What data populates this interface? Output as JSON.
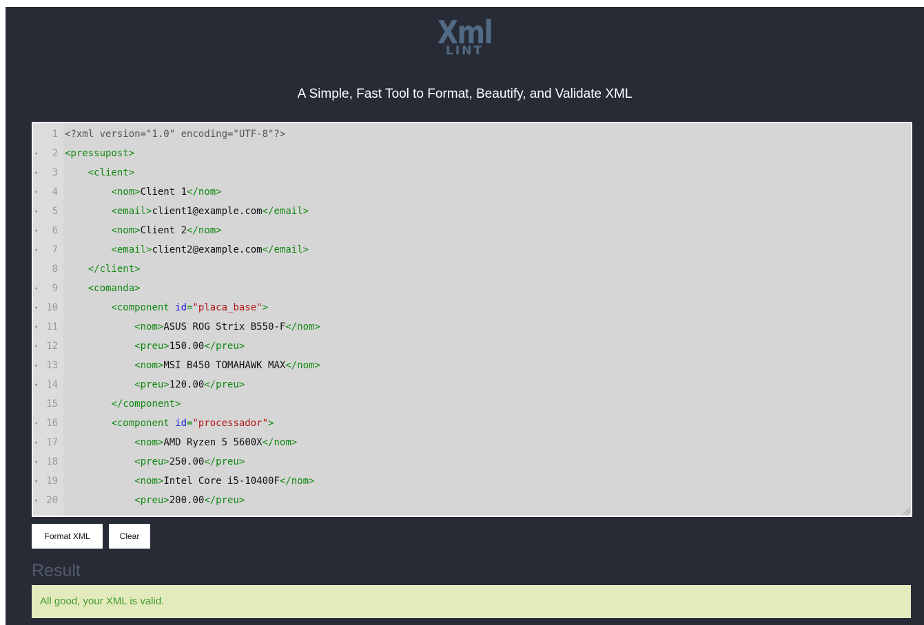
{
  "header": {
    "logo_main": "Xml",
    "logo_sub": "LINT",
    "tagline": "A Simple, Fast Tool to Format, Beautify, and Validate XML"
  },
  "editor": {
    "lines": [
      {
        "n": "1",
        "fold": false,
        "indent": 0,
        "tokens": [
          [
            "decl",
            "<?xml version=\"1.0\" encoding=\"UTF-8\"?>"
          ]
        ]
      },
      {
        "n": "2",
        "fold": true,
        "indent": 0,
        "tokens": [
          [
            "tag",
            "<pressupost>"
          ]
        ]
      },
      {
        "n": "3",
        "fold": true,
        "indent": 1,
        "tokens": [
          [
            "tag",
            "<client>"
          ]
        ]
      },
      {
        "n": "4",
        "fold": true,
        "indent": 2,
        "tokens": [
          [
            "tag",
            "<nom>"
          ],
          [
            "text",
            "Client 1"
          ],
          [
            "tag",
            "</nom>"
          ]
        ]
      },
      {
        "n": "5",
        "fold": true,
        "indent": 2,
        "tokens": [
          [
            "tag",
            "<email>"
          ],
          [
            "text",
            "client1@example.com"
          ],
          [
            "tag",
            "</email>"
          ]
        ]
      },
      {
        "n": "6",
        "fold": true,
        "indent": 2,
        "tokens": [
          [
            "tag",
            "<nom>"
          ],
          [
            "text",
            "Client 2"
          ],
          [
            "tag",
            "</nom>"
          ]
        ]
      },
      {
        "n": "7",
        "fold": true,
        "indent": 2,
        "tokens": [
          [
            "tag",
            "<email>"
          ],
          [
            "text",
            "client2@example.com"
          ],
          [
            "tag",
            "</email>"
          ]
        ]
      },
      {
        "n": "8",
        "fold": false,
        "indent": 1,
        "tokens": [
          [
            "tag",
            "</client>"
          ]
        ]
      },
      {
        "n": "9",
        "fold": true,
        "indent": 1,
        "tokens": [
          [
            "tag",
            "<comanda>"
          ]
        ]
      },
      {
        "n": "10",
        "fold": true,
        "indent": 2,
        "tokens": [
          [
            "tag",
            "<component "
          ],
          [
            "attr",
            "id"
          ],
          [
            "tag",
            "="
          ],
          [
            "val",
            "\"placa_base\""
          ],
          [
            "tag",
            ">"
          ]
        ]
      },
      {
        "n": "11",
        "fold": true,
        "indent": 3,
        "tokens": [
          [
            "tag",
            "<nom>"
          ],
          [
            "text",
            "ASUS ROG Strix B550-F"
          ],
          [
            "tag",
            "</nom>"
          ]
        ]
      },
      {
        "n": "12",
        "fold": true,
        "indent": 3,
        "tokens": [
          [
            "tag",
            "<preu>"
          ],
          [
            "text",
            "150.00"
          ],
          [
            "tag",
            "</preu>"
          ]
        ]
      },
      {
        "n": "13",
        "fold": true,
        "indent": 3,
        "tokens": [
          [
            "tag",
            "<nom>"
          ],
          [
            "text",
            "MSI B450 TOMAHAWK MAX"
          ],
          [
            "tag",
            "</nom>"
          ]
        ]
      },
      {
        "n": "14",
        "fold": true,
        "indent": 3,
        "tokens": [
          [
            "tag",
            "<preu>"
          ],
          [
            "text",
            "120.00"
          ],
          [
            "tag",
            "</preu>"
          ]
        ]
      },
      {
        "n": "15",
        "fold": false,
        "indent": 2,
        "tokens": [
          [
            "tag",
            "</component>"
          ]
        ]
      },
      {
        "n": "16",
        "fold": true,
        "indent": 2,
        "tokens": [
          [
            "tag",
            "<component "
          ],
          [
            "attr",
            "id"
          ],
          [
            "tag",
            "="
          ],
          [
            "val",
            "\"processador\""
          ],
          [
            "tag",
            ">"
          ]
        ]
      },
      {
        "n": "17",
        "fold": true,
        "indent": 3,
        "tokens": [
          [
            "tag",
            "<nom>"
          ],
          [
            "text",
            "AMD Ryzen 5 5600X"
          ],
          [
            "tag",
            "</nom>"
          ]
        ]
      },
      {
        "n": "18",
        "fold": true,
        "indent": 3,
        "tokens": [
          [
            "tag",
            "<preu>"
          ],
          [
            "text",
            "250.00"
          ],
          [
            "tag",
            "</preu>"
          ]
        ]
      },
      {
        "n": "19",
        "fold": true,
        "indent": 3,
        "tokens": [
          [
            "tag",
            "<nom>"
          ],
          [
            "text",
            "Intel Core i5-10400F"
          ],
          [
            "tag",
            "</nom>"
          ]
        ]
      },
      {
        "n": "20",
        "fold": true,
        "indent": 3,
        "tokens": [
          [
            "tag",
            "<preu>"
          ],
          [
            "text",
            "200.00"
          ],
          [
            "tag",
            "</preu>"
          ]
        ]
      }
    ]
  },
  "buttons": {
    "format_label": "Format XML",
    "clear_label": "Clear"
  },
  "result": {
    "title": "Result",
    "message": "All good, your XML is valid."
  }
}
